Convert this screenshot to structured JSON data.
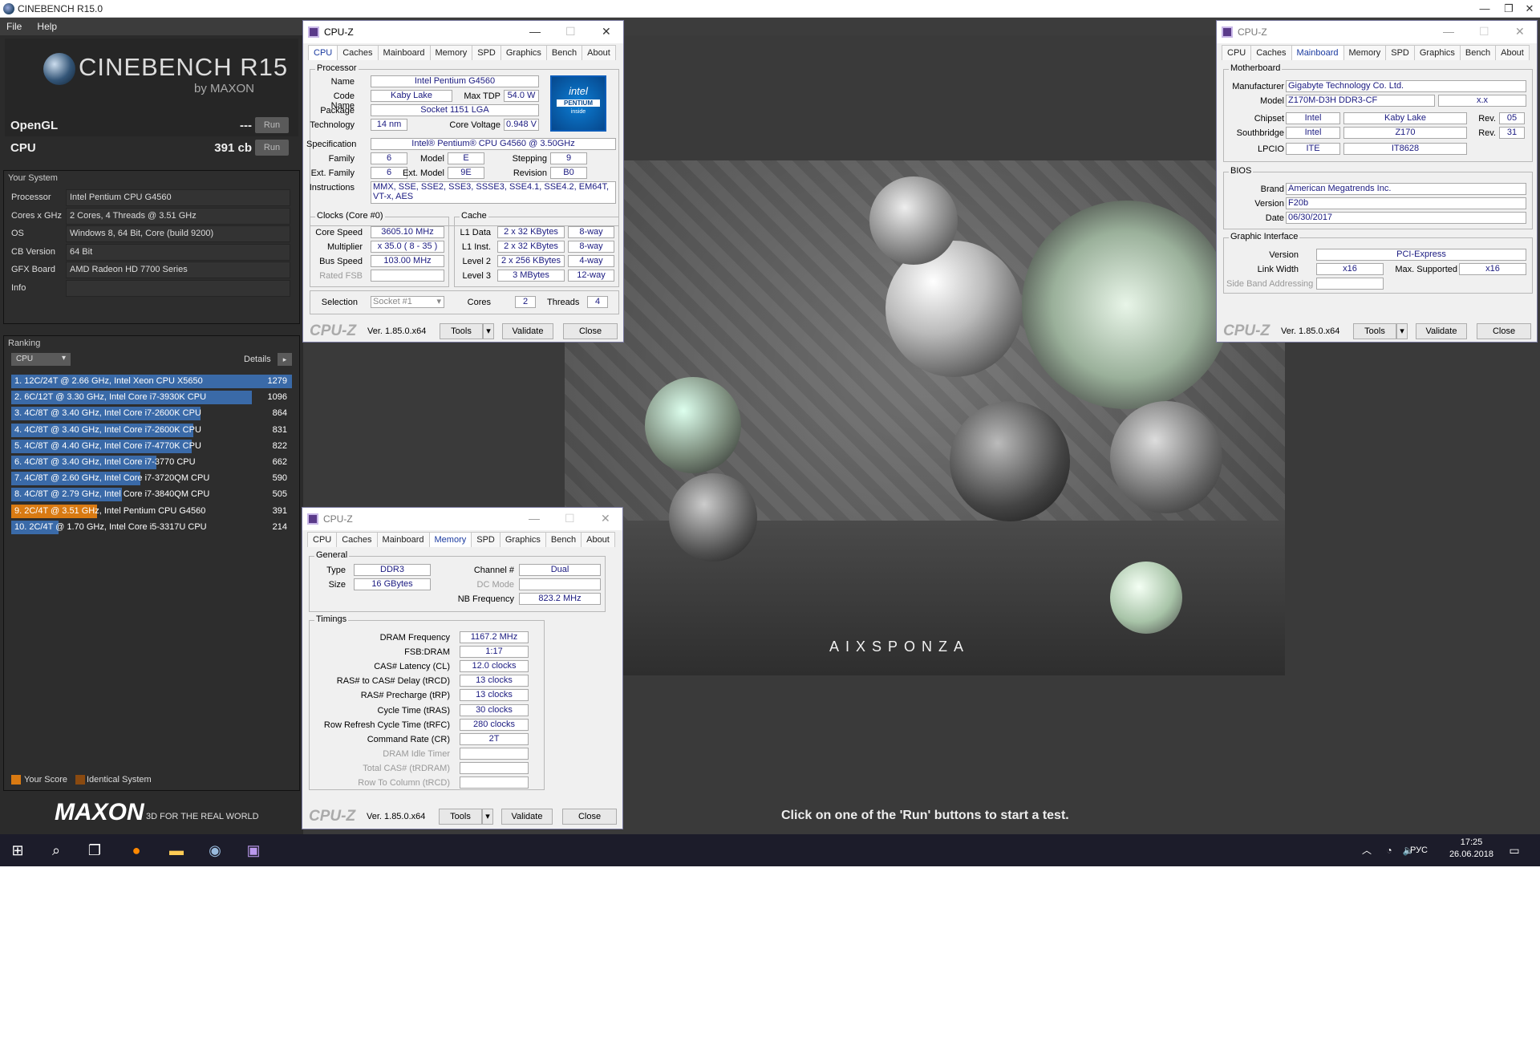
{
  "cinebench": {
    "window_title": "CINEBENCH R15.0",
    "menu": [
      "File",
      "Help"
    ],
    "logo_title": "CINEBENCH R15",
    "logo_sub": "by MAXON",
    "opengl_label": "OpenGL",
    "opengl_value": "---",
    "cpu_label": "CPU",
    "cpu_value": "391 cb",
    "run_label": "Run",
    "your_system_title": "Your System",
    "system": [
      {
        "key": "Processor",
        "value": "Intel Pentium CPU G4560"
      },
      {
        "key": "Cores x GHz",
        "value": "2 Cores, 4 Threads @ 3.51 GHz"
      },
      {
        "key": "OS",
        "value": "Windows 8, 64 Bit, Core (build 9200)"
      },
      {
        "key": "CB Version",
        "value": "64 Bit"
      },
      {
        "key": "GFX Board",
        "value": "AMD Radeon HD 7700 Series"
      },
      {
        "key": "Info",
        "value": ""
      }
    ],
    "ranking_title": "Ranking",
    "ranking_select": "CPU",
    "details_label": "Details",
    "ranking": [
      {
        "text": "1. 12C/24T @ 2.66 GHz, Intel Xeon CPU X5650",
        "score": "1279",
        "value": 1279,
        "highlight": false
      },
      {
        "text": "2. 6C/12T @ 3.30 GHz,  Intel Core i7-3930K CPU",
        "score": "1096",
        "value": 1096,
        "highlight": false
      },
      {
        "text": "3. 4C/8T @ 3.40 GHz,  Intel Core i7-2600K CPU",
        "score": "864",
        "value": 864,
        "highlight": false
      },
      {
        "text": "4. 4C/8T @ 3.40 GHz,  Intel Core i7-2600K CPU",
        "score": "831",
        "value": 831,
        "highlight": false
      },
      {
        "text": "5. 4C/8T @ 4.40 GHz, Intel Core i7-4770K CPU",
        "score": "822",
        "value": 822,
        "highlight": false
      },
      {
        "text": "6. 4C/8T @ 3.40 GHz,  Intel Core i7-3770 CPU",
        "score": "662",
        "value": 662,
        "highlight": false
      },
      {
        "text": "7. 4C/8T @ 2.60 GHz, Intel Core i7-3720QM CPU",
        "score": "590",
        "value": 590,
        "highlight": false
      },
      {
        "text": "8. 4C/8T @ 2.79 GHz,  Intel Core i7-3840QM CPU",
        "score": "505",
        "value": 505,
        "highlight": false
      },
      {
        "text": "9. 2C/4T @ 3.51 GHz, Intel Pentium CPU G4560",
        "score": "391",
        "value": 391,
        "highlight": true
      },
      {
        "text": "10. 2C/4T @ 1.70 GHz,  Intel Core i5-3317U CPU",
        "score": "214",
        "value": 214,
        "highlight": false
      }
    ],
    "legend_your_score": "Your Score",
    "legend_identical": "Identical System",
    "maxon_logo": "MAXON",
    "maxon_tagline": "3D FOR THE REAL WORLD",
    "render_brand": "AIXSPONZA",
    "hint": "Click on one of the 'Run' buttons to start a test.",
    "colors": {
      "bar": "#3a6aa8",
      "your_score": "#d97a12",
      "identical": "#8a4a10"
    }
  },
  "cpuz_common": {
    "title": "CPU-Z",
    "tabs": [
      "CPU",
      "Caches",
      "Mainboard",
      "Memory",
      "SPD",
      "Graphics",
      "Bench",
      "About"
    ],
    "logo": "CPU-Z",
    "version": "Ver. 1.85.0.x64",
    "tools": "Tools",
    "validate": "Validate",
    "close": "Close"
  },
  "cpuz_cpu": {
    "processor_group": "Processor",
    "name_label": "Name",
    "name": "Intel Pentium G4560",
    "codename_label": "Code Name",
    "codename": "Kaby Lake",
    "maxtdp_label": "Max TDP",
    "maxtdp": "54.0 W",
    "package_label": "Package",
    "package": "Socket 1151 LGA",
    "technology_label": "Technology",
    "technology": "14 nm",
    "voltage_label": "Core Voltage",
    "voltage": "0.948 V",
    "spec_label": "Specification",
    "spec": "Intel® Pentium® CPU G4560 @ 3.50GHz",
    "family_label": "Family",
    "family": "6",
    "model_label": "Model",
    "model": "E",
    "stepping_label": "Stepping",
    "stepping": "9",
    "extfamily_label": "Ext. Family",
    "extfamily": "6",
    "extmodel_label": "Ext. Model",
    "extmodel": "9E",
    "revision_label": "Revision",
    "revision": "B0",
    "instructions_label": "Instructions",
    "instructions": "MMX, SSE, SSE2, SSE3, SSSE3, SSE4.1, SSE4.2, EM64T, VT-x, AES",
    "clocks_group": "Clocks (Core #0)",
    "corespeed_label": "Core Speed",
    "corespeed": "3605.10 MHz",
    "multiplier_label": "Multiplier",
    "multiplier": "x 35.0 ( 8 - 35 )",
    "busspeed_label": "Bus Speed",
    "busspeed": "103.00 MHz",
    "ratedfsb_label": "Rated FSB",
    "ratedfsb": "",
    "cache_group": "Cache",
    "l1d_label": "L1 Data",
    "l1d": "2 x 32 KBytes",
    "l1d_way": "8-way",
    "l1i_label": "L1 Inst.",
    "l1i": "2 x 32 KBytes",
    "l1i_way": "8-way",
    "l2_label": "Level 2",
    "l2": "2 x 256 KBytes",
    "l2_way": "4-way",
    "l3_label": "Level 3",
    "l3": "3 MBytes",
    "l3_way": "12-way",
    "selection_label": "Selection",
    "selection": "Socket #1",
    "cores_label": "Cores",
    "cores": "2",
    "threads_label": "Threads",
    "threads": "4",
    "intel_logo_top": "intel",
    "intel_logo_mid": "PENTIUM",
    "intel_logo_bot": "inside"
  },
  "cpuz_mem": {
    "general_group": "General",
    "type_label": "Type",
    "type": "DDR3",
    "size_label": "Size",
    "size": "16 GBytes",
    "channel_label": "Channel #",
    "channel": "Dual",
    "dcmode_label": "DC Mode",
    "dcmode": "",
    "nbfreq_label": "NB Frequency",
    "nbfreq": "823.2 MHz",
    "timings_group": "Timings",
    "timings": [
      {
        "label": "DRAM Frequency",
        "value": "1167.2 MHz",
        "dis": false
      },
      {
        "label": "FSB:DRAM",
        "value": "1:17",
        "dis": false
      },
      {
        "label": "CAS# Latency (CL)",
        "value": "12.0 clocks",
        "dis": false
      },
      {
        "label": "RAS# to CAS# Delay (tRCD)",
        "value": "13 clocks",
        "dis": false
      },
      {
        "label": "RAS# Precharge (tRP)",
        "value": "13 clocks",
        "dis": false
      },
      {
        "label": "Cycle Time (tRAS)",
        "value": "30 clocks",
        "dis": false
      },
      {
        "label": "Row Refresh Cycle Time (tRFC)",
        "value": "280 clocks",
        "dis": false
      },
      {
        "label": "Command Rate (CR)",
        "value": "2T",
        "dis": false
      },
      {
        "label": "DRAM Idle Timer",
        "value": "",
        "dis": true
      },
      {
        "label": "Total CAS# (tRDRAM)",
        "value": "",
        "dis": true
      },
      {
        "label": "Row To Column (tRCD)",
        "value": "",
        "dis": true
      }
    ]
  },
  "cpuz_mb": {
    "motherboard_group": "Motherboard",
    "manufacturer_label": "Manufacturer",
    "manufacturer": "Gigabyte Technology Co. Ltd.",
    "model_label": "Model",
    "model": "Z170M-D3H DDR3-CF",
    "model_rev": "x.x",
    "chipset_label": "Chipset",
    "chipset_vendor": "Intel",
    "chipset": "Kaby Lake",
    "chipset_rev_label": "Rev.",
    "chipset_rev": "05",
    "southbridge_label": "Southbridge",
    "sb_vendor": "Intel",
    "sb": "Z170",
    "sb_rev_label": "Rev.",
    "sb_rev": "31",
    "lpcio_label": "LPCIO",
    "lpcio_vendor": "ITE",
    "lpcio": "IT8628",
    "bios_group": "BIOS",
    "brand_label": "Brand",
    "brand": "American Megatrends Inc.",
    "biosver_label": "Version",
    "biosver": "F20b",
    "date_label": "Date",
    "date": "06/30/2017",
    "gi_group": "Graphic Interface",
    "giver_label": "Version",
    "giver": "PCI-Express",
    "linkwidth_label": "Link Width",
    "linkwidth": "x16",
    "maxsup_label": "Max. Supported",
    "maxsup": "x16",
    "sba_label": "Side Band Addressing"
  },
  "taskbar": {
    "lang": "РУС",
    "time": "17:25",
    "date": "26.06.2018"
  }
}
